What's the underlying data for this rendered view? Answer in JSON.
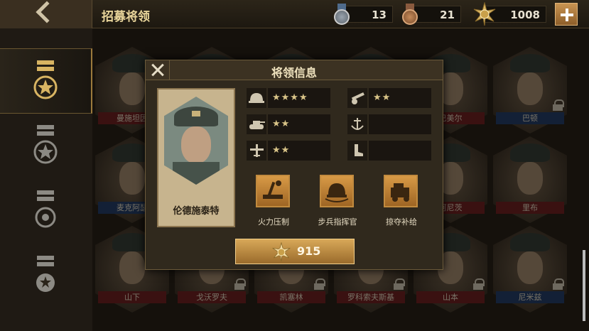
{
  "header": {
    "title": "招募将领"
  },
  "resources": [
    {
      "icon": "silver-medal-icon",
      "value": "13"
    },
    {
      "icon": "bronze-medal-icon",
      "value": "21"
    },
    {
      "icon": "gold-star-medal-icon",
      "value": "1008"
    }
  ],
  "tabs": [
    {
      "icon": "general-rank-1-icon",
      "active": true
    },
    {
      "icon": "general-rank-2-icon",
      "active": false
    },
    {
      "icon": "general-rank-3-icon",
      "active": false
    },
    {
      "icon": "general-rank-4-icon",
      "active": false
    }
  ],
  "generals": [
    {
      "name": "曼施坦因",
      "team": "red",
      "locked": false
    },
    {
      "name": "",
      "team": "red",
      "locked": false
    },
    {
      "name": "",
      "team": "red",
      "locked": false
    },
    {
      "name": "",
      "team": "red",
      "locked": false
    },
    {
      "name": "巴美尔",
      "team": "red",
      "locked": false
    },
    {
      "name": "巴顿",
      "team": "blue",
      "locked": true
    },
    {
      "name": "麦克阿瑟",
      "team": "blue",
      "locked": false
    },
    {
      "name": "",
      "team": "blue",
      "locked": false
    },
    {
      "name": "",
      "team": "blue",
      "locked": false
    },
    {
      "name": "",
      "team": "blue",
      "locked": false
    },
    {
      "name": "阿尼茨",
      "team": "red",
      "locked": false
    },
    {
      "name": "里布",
      "team": "red",
      "locked": false
    },
    {
      "name": "山下",
      "team": "red",
      "locked": false
    },
    {
      "name": "戈沃罗夫",
      "team": "red",
      "locked": true
    },
    {
      "name": "凯塞林",
      "team": "red",
      "locked": true
    },
    {
      "name": "罗科索夫斯基",
      "team": "red",
      "locked": true
    },
    {
      "name": "山本",
      "team": "red",
      "locked": true
    },
    {
      "name": "尼米兹",
      "team": "blue",
      "locked": true
    }
  ],
  "modal": {
    "title": "将领信息",
    "general_name": "伦德施泰特",
    "stats": [
      {
        "icon": "infantry-helmet-icon",
        "stars": "★★★★"
      },
      {
        "icon": "artillery-icon",
        "stars": "★★"
      },
      {
        "icon": "tank-icon",
        "stars": "★★"
      },
      {
        "icon": "navy-anchor-icon",
        "stars": ""
      },
      {
        "icon": "aircraft-icon",
        "stars": "★★"
      },
      {
        "icon": "boot-icon",
        "stars": ""
      }
    ],
    "skills": [
      {
        "icon": "fire-suppression-icon",
        "label": "火力压制"
      },
      {
        "icon": "infantry-commander-icon",
        "label": "步兵指挥官"
      },
      {
        "icon": "plunder-supply-icon",
        "label": "掠夺补给"
      }
    ],
    "cost": "915"
  }
}
